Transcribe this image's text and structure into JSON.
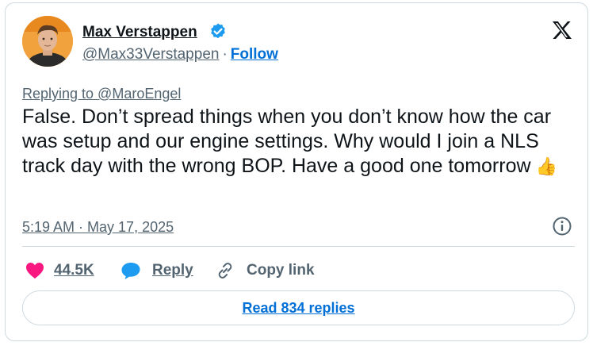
{
  "author": {
    "name": "Max Verstappen",
    "handle": "@Max33Verstappen",
    "separator": "·",
    "follow_label": "Follow",
    "verified_color": "#1d9bf0"
  },
  "tweet": {
    "replying_to": "Replying to @MaroEngel",
    "text": "False. Don’t spread things when you don’t know how the car was setup and our engine settings. Why would I join a NLS track day with the wrong BOP. Have a good one tomorrow",
    "emoji": "👍",
    "timestamp": "5:19 AM · May 17, 2025"
  },
  "actions": {
    "like_count": "44.5K",
    "reply_label": "Reply",
    "copy_link_label": "Copy link",
    "like_color": "#f91880",
    "reply_color": "#1d9bf0"
  },
  "footer": {
    "read_replies_label": "Read 834 replies"
  },
  "icons": [
    "verified-badge-icon",
    "x-logo-icon",
    "info-icon",
    "heart-icon",
    "reply-bubble-icon",
    "link-icon"
  ]
}
